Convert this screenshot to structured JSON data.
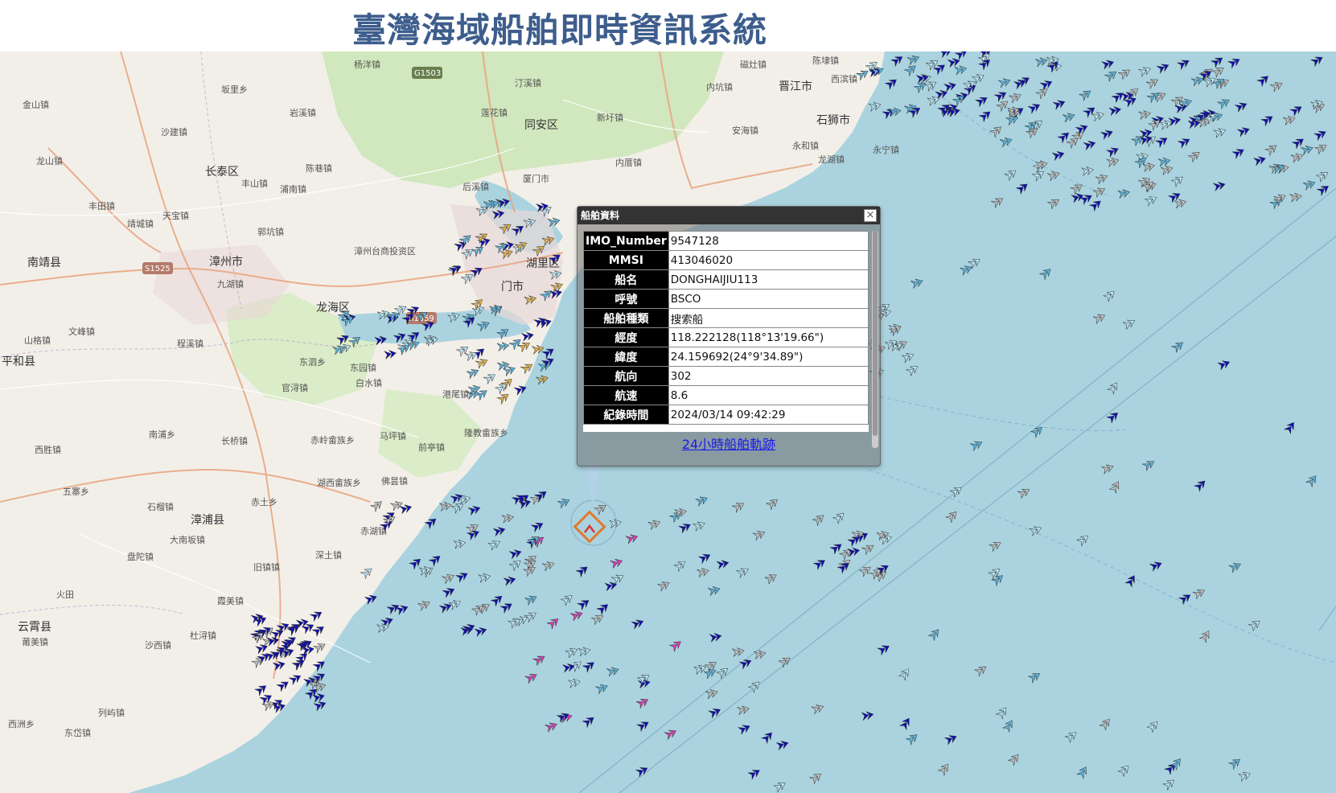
{
  "page": {
    "title": "臺灣海域船舶即時資訊系統"
  },
  "map": {
    "places": [
      {
        "name": "杨洋镇"
      },
      {
        "name": "G1503"
      },
      {
        "name": "汀溪镇"
      },
      {
        "name": "磁灶镇"
      },
      {
        "name": "陈埭镇"
      },
      {
        "name": "坂里乡"
      },
      {
        "name": "岩溪镇"
      },
      {
        "name": "莲花镇"
      },
      {
        "name": "同安区"
      },
      {
        "name": "新圩镇"
      },
      {
        "name": "内坑镇"
      },
      {
        "name": "晋江市"
      },
      {
        "name": "西滨镇"
      },
      {
        "name": "金山镇"
      },
      {
        "name": "沙建镇"
      },
      {
        "name": "石狮市"
      },
      {
        "name": "安海镇"
      },
      {
        "name": "永和镇"
      },
      {
        "name": "永宁镇"
      },
      {
        "name": "龙山镇"
      },
      {
        "name": "陈巷镇"
      },
      {
        "name": "长泰区"
      },
      {
        "name": "丰山镇"
      },
      {
        "name": "浦南镇"
      },
      {
        "name": "厦门市"
      },
      {
        "name": "内厝镇"
      },
      {
        "name": "龙湖镇"
      },
      {
        "name": "后溪镇"
      },
      {
        "name": "丰田镇"
      },
      {
        "name": "天宝镇"
      },
      {
        "name": "靖城镇"
      },
      {
        "name": "郭坑镇"
      },
      {
        "name": "南靖县"
      },
      {
        "name": "漳州市"
      },
      {
        "name": "S1525"
      },
      {
        "name": "九湖镇"
      },
      {
        "name": "湖里区"
      },
      {
        "name": "门市"
      },
      {
        "name": "漳州台商投资区"
      },
      {
        "name": "山格镇"
      },
      {
        "name": "文峰镇"
      },
      {
        "name": "程溪镇"
      },
      {
        "name": "平和县"
      },
      {
        "name": "东泗乡"
      },
      {
        "name": "东园镇"
      },
      {
        "name": "白水镇"
      },
      {
        "name": "官浔镇"
      },
      {
        "name": "港尾镇"
      },
      {
        "name": "南浦乡"
      },
      {
        "name": "长桥镇"
      },
      {
        "name": "赤岭畲族乡"
      },
      {
        "name": "马坪镇"
      },
      {
        "name": "隆教畲族乡"
      },
      {
        "name": "前亭镇"
      },
      {
        "name": "西胜镇"
      },
      {
        "name": "湖西畲族乡"
      },
      {
        "name": "佛昙镇"
      },
      {
        "name": "五寨乡"
      },
      {
        "name": "石榴镇"
      },
      {
        "name": "赤土乡"
      },
      {
        "name": "漳浦县"
      },
      {
        "name": "赤湖镇"
      },
      {
        "name": "大南坂镇"
      },
      {
        "name": "盘陀镇"
      },
      {
        "name": "深土镇"
      },
      {
        "name": "旧镇镇"
      },
      {
        "name": "火田"
      },
      {
        "name": "霞美镇"
      },
      {
        "name": "云霄县"
      },
      {
        "name": "莆美镇"
      },
      {
        "name": "杜浔镇"
      },
      {
        "name": "沙西镇"
      },
      {
        "name": "列屿镇"
      },
      {
        "name": "东岱镇"
      },
      {
        "name": "西洲乡"
      },
      {
        "name": "龙海区"
      },
      {
        "name": "S1559"
      }
    ]
  },
  "popup": {
    "title": "船舶資料",
    "close_label": "×",
    "rows": [
      {
        "key": "IMO_Number",
        "value": "9547128"
      },
      {
        "key": "MMSI",
        "value": "413046020"
      },
      {
        "key": "船名",
        "value": "DONGHAIJIU113"
      },
      {
        "key": "呼號",
        "value": "BSCO"
      },
      {
        "key": "船舶種類",
        "value": "搜索船"
      },
      {
        "key": "經度",
        "value": "118.222128(118°13'19.66\")"
      },
      {
        "key": "緯度",
        "value": "24.159692(24°9'34.89\")"
      },
      {
        "key": "航向",
        "value": "302"
      },
      {
        "key": "航速",
        "value": "8.6"
      },
      {
        "key": "紀錄時間",
        "value": "2024/03/14 09:42:29"
      }
    ],
    "track_link": "24小時船舶軌跡"
  },
  "colors": {
    "sea": "#aad3df",
    "land": "#f2efe9",
    "green": "#cde6b8",
    "ship_navy": "#1010b0",
    "ship_blue": "#5ab4dc",
    "ship_light": "#b9e6f5",
    "ship_gray": "#bfbfbf",
    "ship_pink": "#d63fb5",
    "title": "#3d5d8c"
  }
}
